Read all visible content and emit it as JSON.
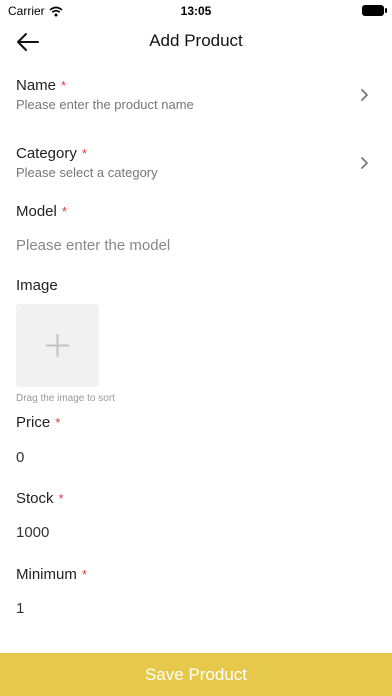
{
  "status": {
    "carrier": "Carrier",
    "time": "13:05"
  },
  "nav": {
    "title": "Add Product"
  },
  "form": {
    "required_mark": "*",
    "name": {
      "label": "Name",
      "placeholder": "Please enter the product name"
    },
    "category": {
      "label": "Category",
      "placeholder": "Please select a category"
    },
    "model": {
      "label": "Model",
      "placeholder": "Please enter the model"
    },
    "image": {
      "label": "Image",
      "hint": "Drag the image to sort"
    },
    "price": {
      "label": "Price",
      "value": "0"
    },
    "stock": {
      "label": "Stock",
      "value": "1000"
    },
    "minimum": {
      "label": "Minimum",
      "value": "1"
    }
  },
  "footer": {
    "save_label": "Save Product"
  },
  "colors": {
    "accent": "#e6c94a",
    "required": "#e23b3b"
  }
}
